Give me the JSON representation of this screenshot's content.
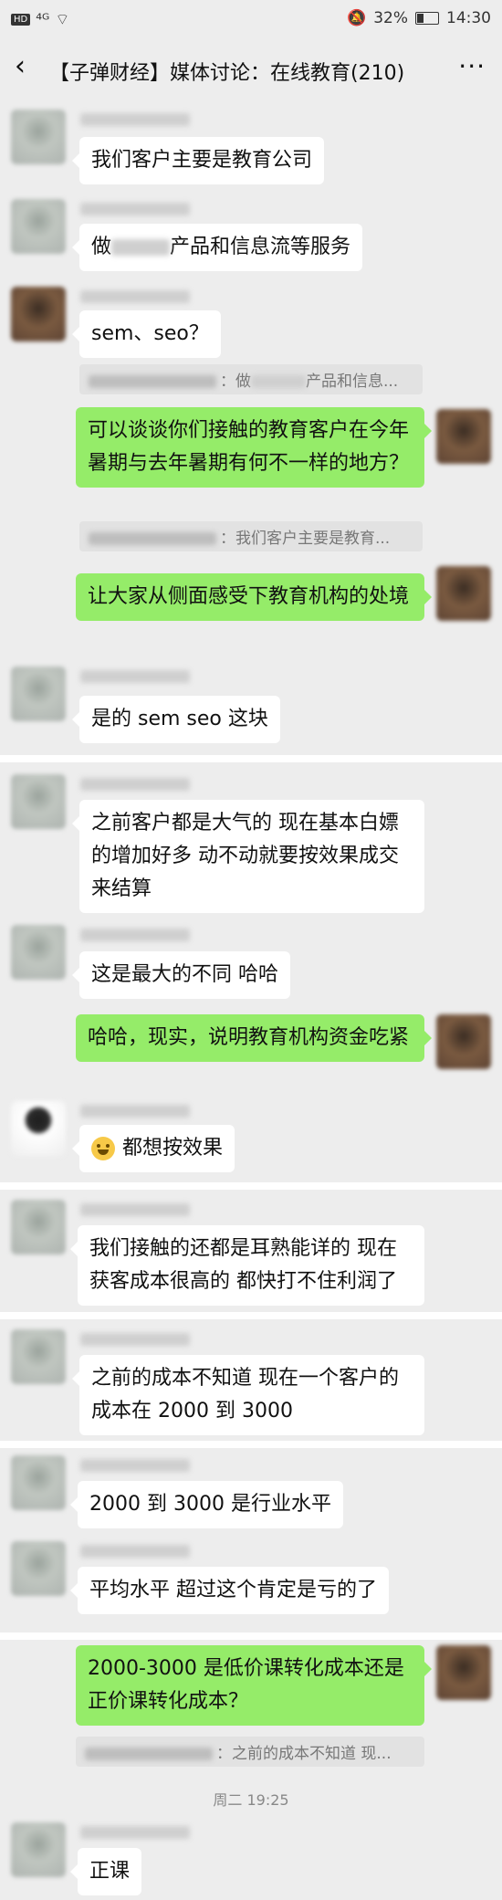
{
  "status": {
    "carrier": "HD",
    "signal": "⁴ᴳ",
    "battery": "32%",
    "time": "14:30"
  },
  "header": {
    "title": "【子弹财经】媒体讨论：在线教育(210)",
    "back_icon": "‹",
    "more_icon": "···"
  },
  "messages": [
    {
      "text": "我们客户主要是教育公司"
    },
    {
      "text_prefix": "做",
      "text_suffix": "产品和信息流等服务"
    },
    {
      "text": "sem、seo？",
      "quote": "：做",
      "quote_suffix": "产品和信息..."
    },
    {
      "text": "可以谈谈你们接触的教育客户在今年暑期与去年暑期有何不一样的地方？",
      "quote": "：我们客户主要是教育..."
    },
    {
      "text": "让大家从侧面感受下教育机构的处境"
    },
    {
      "text": "是的 sem seo 这块"
    },
    {
      "text": "之前客户都是大气的 现在基本白嫖的增加好多 动不动就要按效果成交来结算"
    },
    {
      "text": "这是最大的不同 哈哈"
    },
    {
      "text": "哈哈，现实，说明教育机构资金吃紧"
    },
    {
      "text": "都想按效果"
    },
    {
      "text": "我们接触的还都是耳熟能详的 现在获客成本很高的 都快打不住利润了"
    },
    {
      "text": "之前的成本不知道 现在一个客户的成本在 2000 到 3000"
    },
    {
      "text": "2000 到 3000 是行业水平"
    },
    {
      "text": "平均水平 超过这个肯定是亏的了"
    },
    {
      "text": "2000-3000 是低价课转化成本还是正价课转化成本？",
      "quote": "：之前的成本不知道 现..."
    },
    {
      "text": "正课"
    }
  ],
  "timestamp": "周二 19:25"
}
